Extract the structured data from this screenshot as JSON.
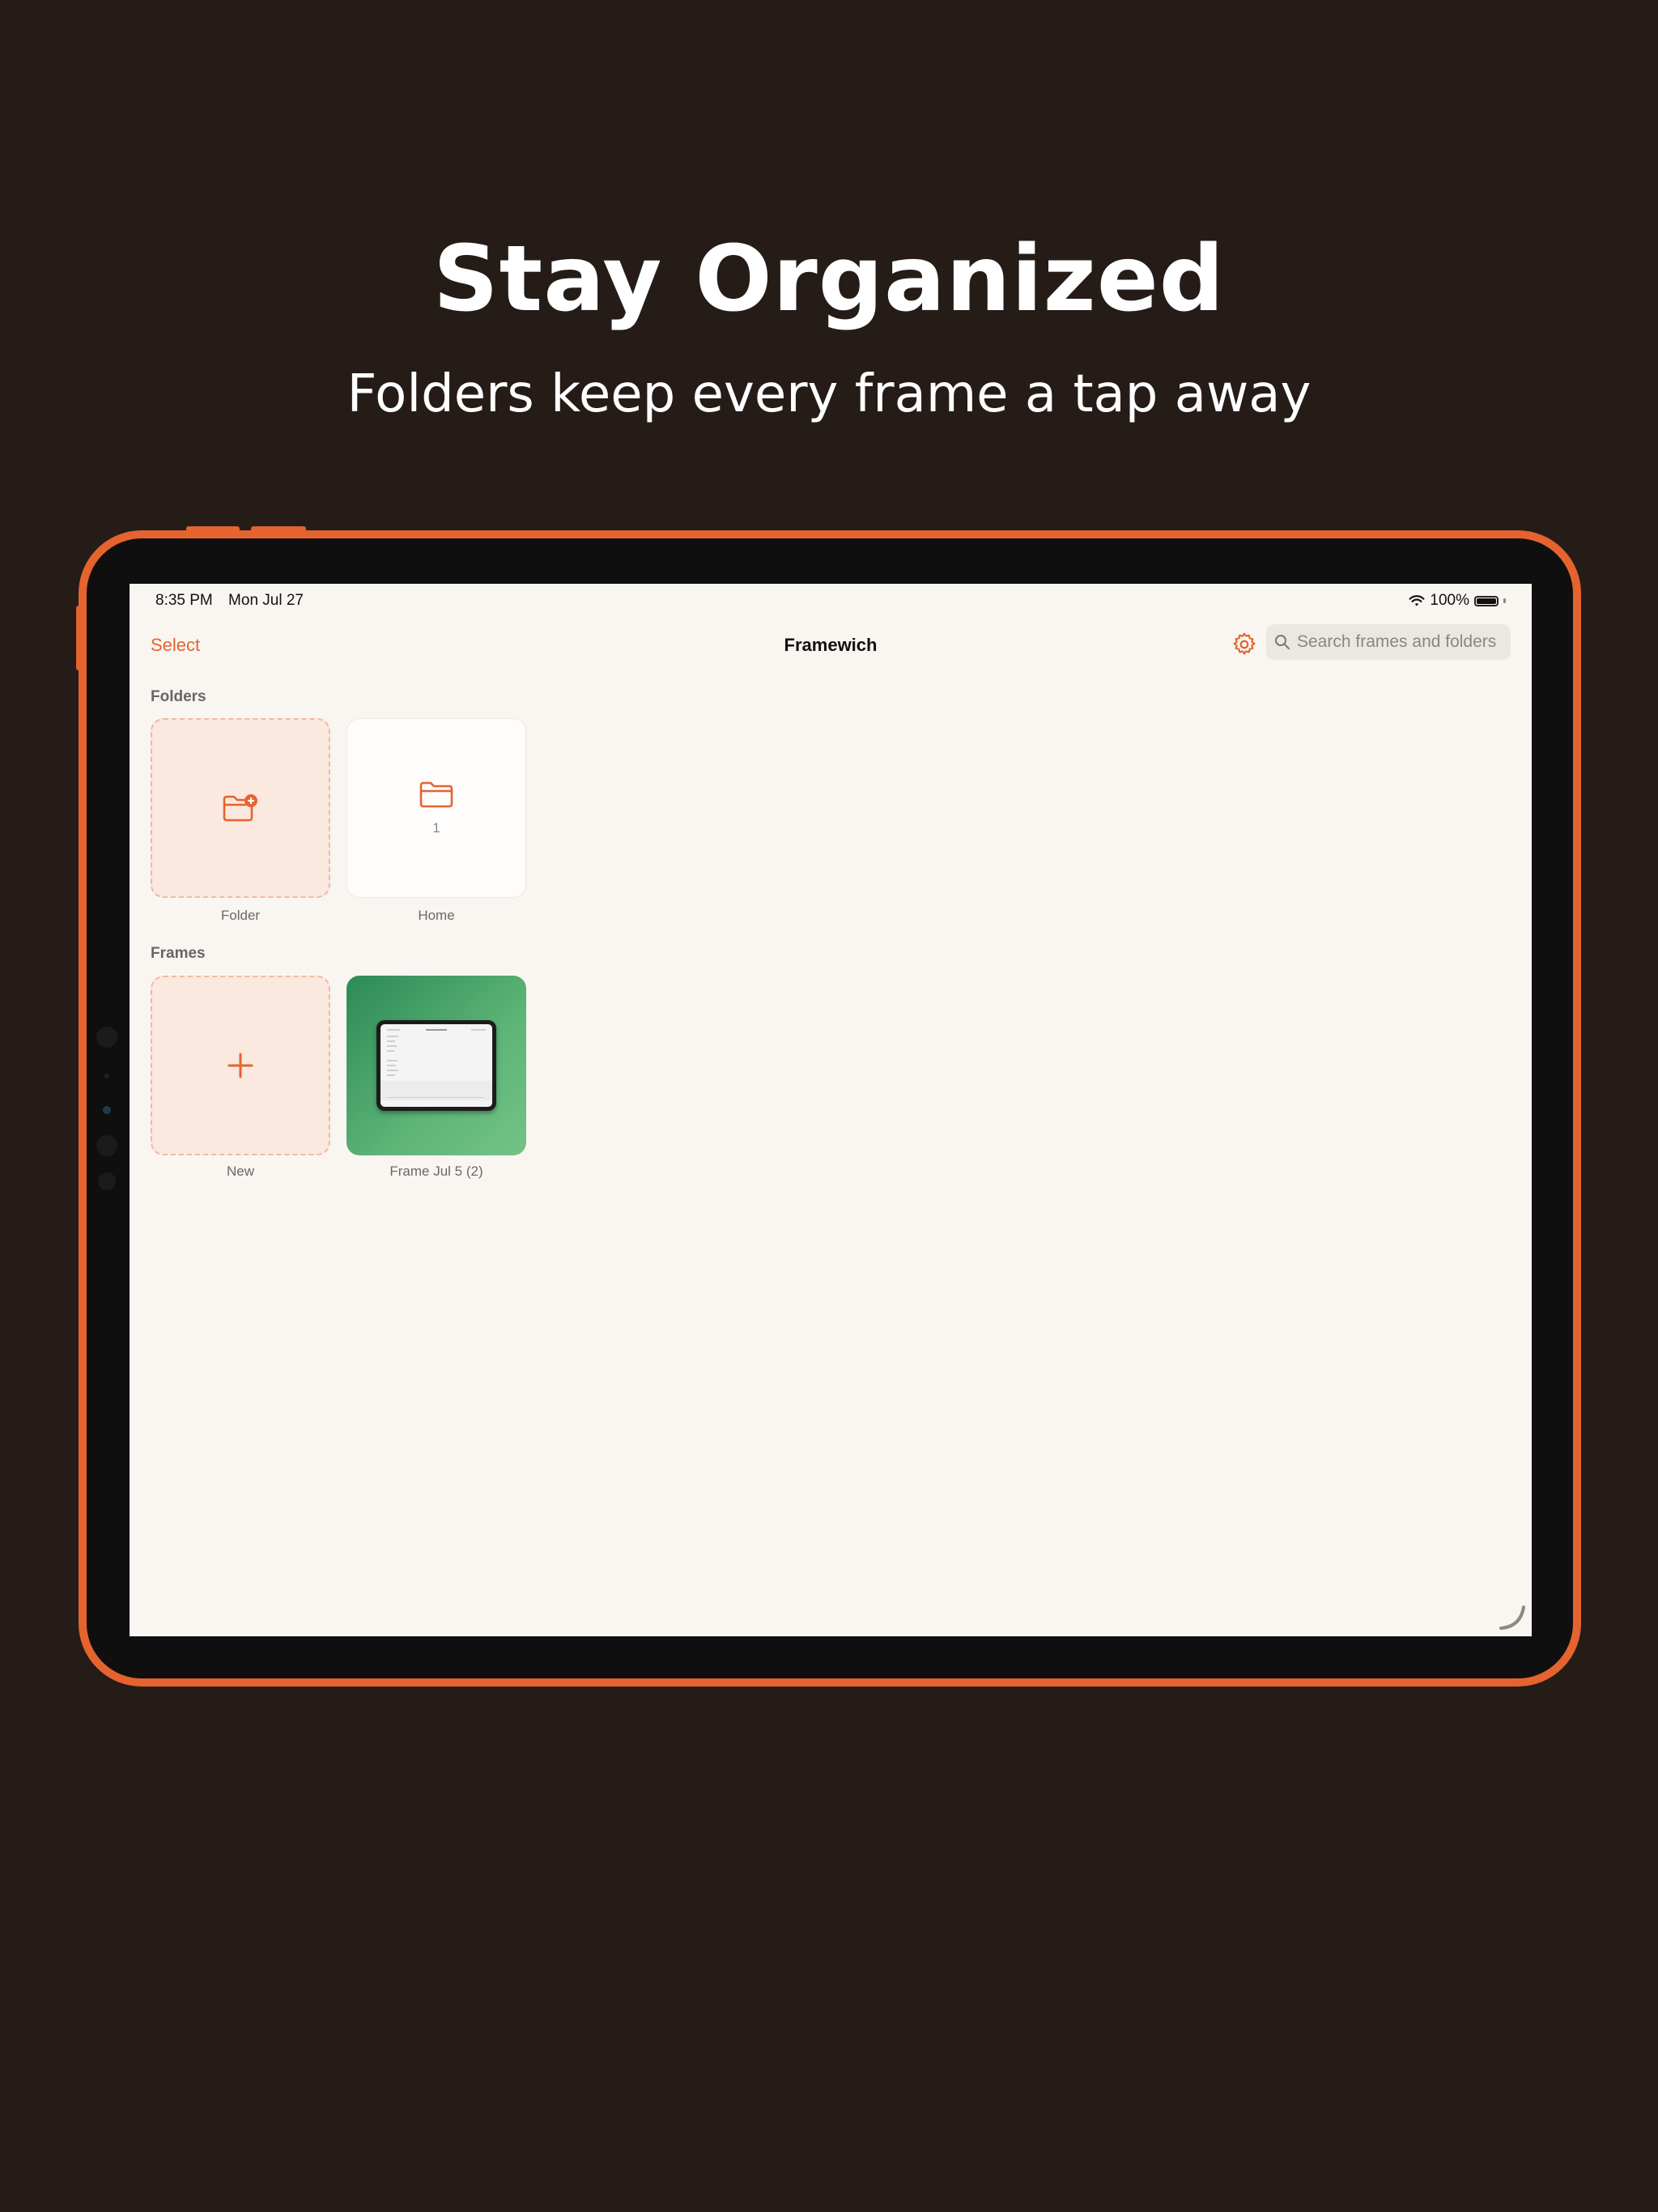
{
  "marketing": {
    "headline": "Stay Organized",
    "subheadline": "Folders keep every frame a tap away"
  },
  "status_bar": {
    "time": "8:35 PM",
    "date": "Mon Jul 27",
    "battery": "100%"
  },
  "nav": {
    "select_label": "Select",
    "title": "Framewich",
    "search_placeholder": "Search frames and folders"
  },
  "folders": {
    "label": "Folders",
    "items": [
      {
        "type": "add",
        "caption": "Folder",
        "icon": "folder-plus-icon"
      },
      {
        "type": "folder",
        "caption": "Home",
        "count": "1",
        "icon": "folder-icon"
      }
    ]
  },
  "frames": {
    "label": "Frames",
    "items": [
      {
        "type": "add",
        "caption": "New",
        "icon": "plus-icon"
      },
      {
        "type": "frame",
        "caption": "Frame Jul 5 (2)"
      }
    ]
  },
  "colors": {
    "accent": "#e5632f",
    "background": "#251c18",
    "screen": "#f9f6f2",
    "add_tile": "#fbe8df",
    "frame_green": "#3f9e62"
  }
}
